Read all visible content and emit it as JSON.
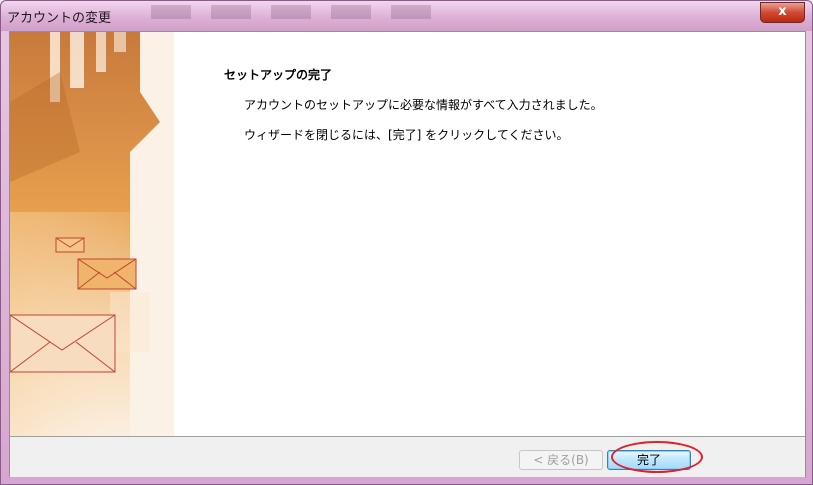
{
  "window": {
    "title": "アカウントの変更",
    "close_glyph": "x"
  },
  "content": {
    "heading": "セットアップの完了",
    "line1": "アカウントのセットアップに必要な情報がすべて入力されました。",
    "line2": "ウィザードを閉じるには、[完了] をクリックしてください。"
  },
  "buttons": {
    "back_label": "< 戻る(B)",
    "finish_label": "完了",
    "back_enabled": false
  },
  "colors": {
    "accent": "#e0202a",
    "title_bar": "#ddb0d7",
    "side_panel_orange": "#e8922a"
  },
  "icons": [
    "close-icon",
    "envelope-icon"
  ]
}
